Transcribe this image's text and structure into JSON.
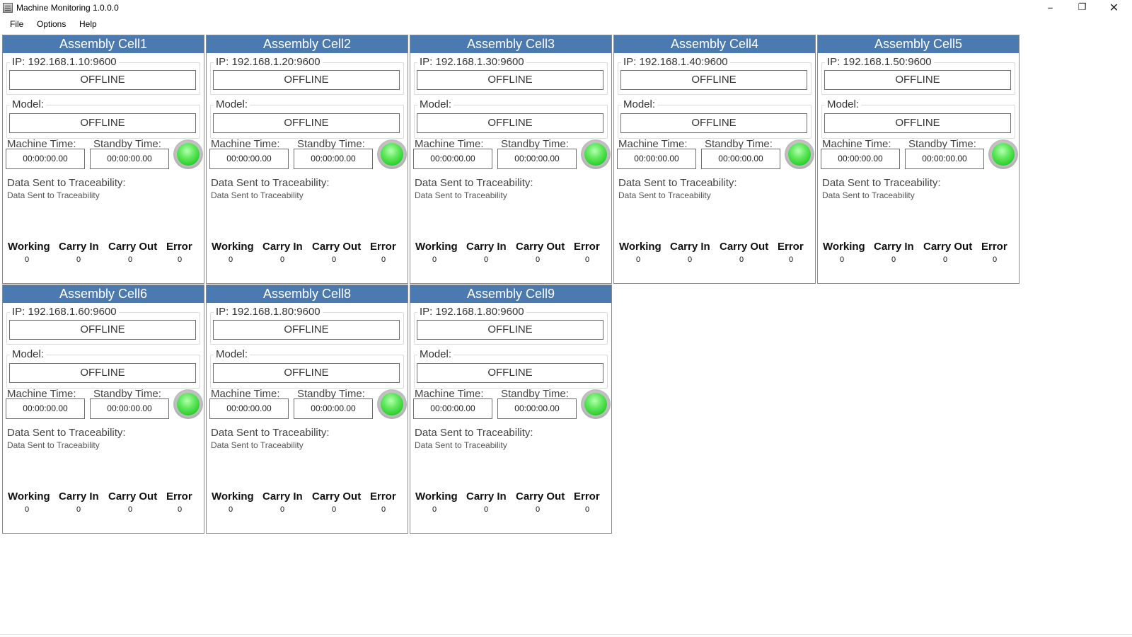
{
  "window": {
    "title": "Machine Monitoring 1.0.0.0",
    "controls": {
      "minimize": "–",
      "maximize": "❐",
      "close": "✕"
    }
  },
  "menu": {
    "file": "File",
    "options": "Options",
    "help": "Help"
  },
  "labels": {
    "model": "Model:",
    "machine_time": "Machine Time:",
    "standby_time": "Standby Time:",
    "data_sent": "Data Sent to Traceability:",
    "working": "Working",
    "carry_in": "Carry In",
    "carry_out": "Carry Out",
    "error": "Error"
  },
  "colors": {
    "header": "#4b7ab0",
    "led": "#5de85a"
  },
  "cells": [
    {
      "title": "Assembly Cell1",
      "ip": "IP: 192.168.1.10:9600",
      "ip_status": "OFFLINE",
      "model_status": "OFFLINE",
      "machine_time": "00:00:00.00",
      "standby_time": "00:00:00.00",
      "data_sent": "Data Sent to Traceability",
      "working": "0",
      "carry_in": "0",
      "carry_out": "0",
      "error": "0",
      "indicator": "green"
    },
    {
      "title": "Assembly Cell2",
      "ip": "IP: 192.168.1.20:9600",
      "ip_status": "OFFLINE",
      "model_status": "OFFLINE",
      "machine_time": "00:00:00.00",
      "standby_time": "00:00:00.00",
      "data_sent": "Data Sent to Traceability",
      "working": "0",
      "carry_in": "0",
      "carry_out": "0",
      "error": "0",
      "indicator": "green"
    },
    {
      "title": "Assembly Cell3",
      "ip": "IP: 192.168.1.30:9600",
      "ip_status": "OFFLINE",
      "model_status": "OFFLINE",
      "machine_time": "00:00:00.00",
      "standby_time": "00:00:00.00",
      "data_sent": "Data Sent to Traceability",
      "working": "0",
      "carry_in": "0",
      "carry_out": "0",
      "error": "0",
      "indicator": "green"
    },
    {
      "title": "Assembly Cell4",
      "ip": "IP: 192.168.1.40:9600",
      "ip_status": "OFFLINE",
      "model_status": "OFFLINE",
      "machine_time": "00:00:00.00",
      "standby_time": "00:00:00.00",
      "data_sent": "Data Sent to Traceability",
      "working": "0",
      "carry_in": "0",
      "carry_out": "0",
      "error": "0",
      "indicator": "green"
    },
    {
      "title": "Assembly Cell5",
      "ip": "IP: 192.168.1.50:9600",
      "ip_status": "OFFLINE",
      "model_status": "OFFLINE",
      "machine_time": "00:00:00.00",
      "standby_time": "00:00:00.00",
      "data_sent": "Data Sent to Traceability",
      "working": "0",
      "carry_in": "0",
      "carry_out": "0",
      "error": "0",
      "indicator": "green"
    },
    {
      "title": "Assembly Cell6",
      "ip": "IP: 192.168.1.60:9600",
      "ip_status": "OFFLINE",
      "model_status": "OFFLINE",
      "machine_time": "00:00:00.00",
      "standby_time": "00:00:00.00",
      "data_sent": "Data Sent to Traceability",
      "working": "0",
      "carry_in": "0",
      "carry_out": "0",
      "error": "0",
      "indicator": "green"
    },
    {
      "title": "Assembly Cell8",
      "ip": "IP: 192.168.1.80:9600",
      "ip_status": "OFFLINE",
      "model_status": "OFFLINE",
      "machine_time": "00:00:00.00",
      "standby_time": "00:00:00.00",
      "data_sent": "Data Sent to Traceability",
      "working": "0",
      "carry_in": "0",
      "carry_out": "0",
      "error": "0",
      "indicator": "green"
    },
    {
      "title": "Assembly Cell9",
      "ip": "IP: 192.168.1.80:9600",
      "ip_status": "OFFLINE",
      "model_status": "OFFLINE",
      "machine_time": "00:00:00.00",
      "standby_time": "00:00:00.00",
      "data_sent": "Data Sent to Traceability",
      "working": "0",
      "carry_in": "0",
      "carry_out": "0",
      "error": "0",
      "indicator": "green"
    }
  ]
}
